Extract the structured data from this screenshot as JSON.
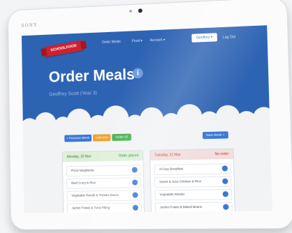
{
  "device": {
    "brand": "SONY"
  },
  "app": {
    "logo_text": "SCHOOLFOOD"
  },
  "nav": {
    "items": [
      {
        "label": "Order Meals"
      },
      {
        "label": "Food ▾"
      },
      {
        "label": "Account ▾"
      }
    ],
    "user_button": "Geoffrey ▾",
    "logout": "Log Out"
  },
  "hero": {
    "title": "Order Meals",
    "subtitle": "Geoffrey Scott (Year 3)"
  },
  "toolbar": {
    "buttons": [
      {
        "label": "« Previous Week",
        "color": "#3a78d6"
      },
      {
        "label": "Unknown",
        "color": "#f0a030"
      },
      {
        "label": "Order All",
        "color": "#4cb050"
      }
    ],
    "next_button": "Next Week »"
  },
  "days": [
    {
      "title": "Monday, 20 Nov",
      "status": "Order placed",
      "header_color": "#dff0d8",
      "title_color": "#2e7d32",
      "meals": [
        {
          "name": "Pizza Margherita"
        },
        {
          "name": "Beef Curry & Rice"
        },
        {
          "name": "Vegetable Ravioli & Tomato Sauce"
        },
        {
          "name": "Jacket Potato & Tuna Filling"
        }
      ]
    },
    {
      "title": "Tuesday, 21 Nov",
      "status": "No order",
      "header_color": "#f2dede",
      "title_color": "#c0392b",
      "meals": [
        {
          "name": "All Day Breakfast"
        },
        {
          "name": "Sweet & Sour Chicken & Rice"
        },
        {
          "name": "Vegetable Risotto"
        },
        {
          "name": "Jacket Potato & Baked Beans"
        }
      ]
    }
  ]
}
